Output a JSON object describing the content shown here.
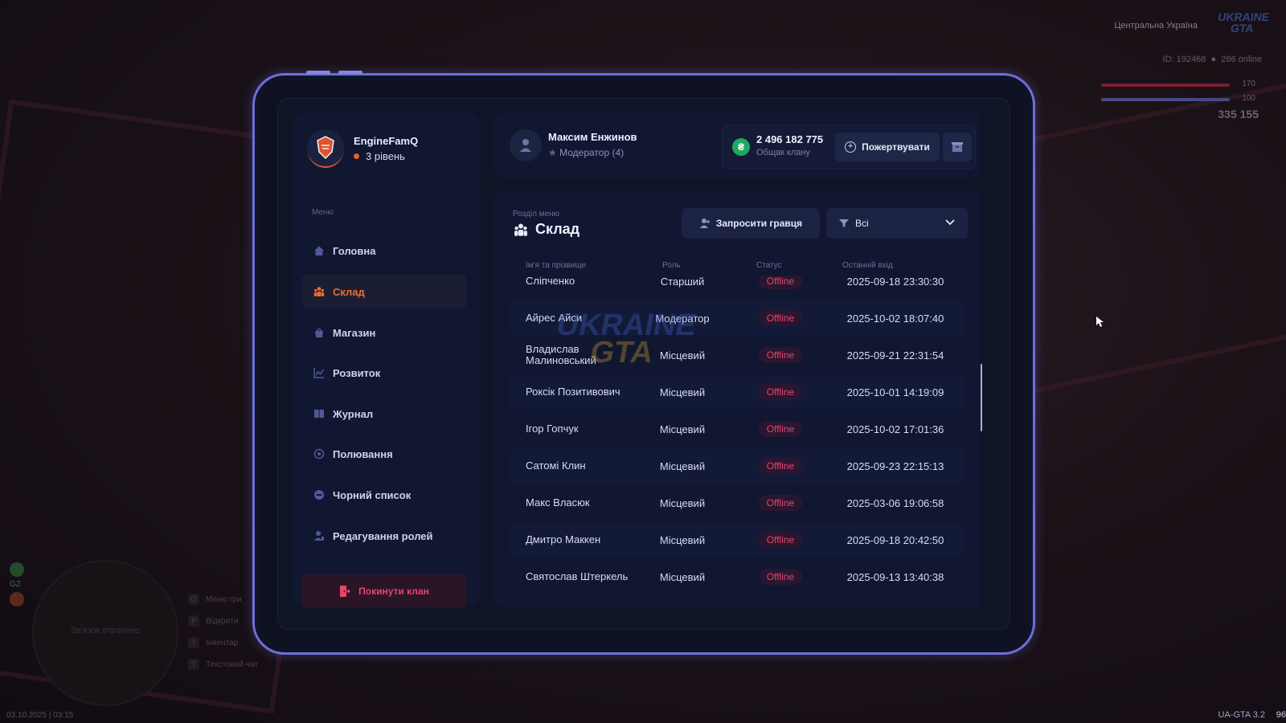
{
  "hud": {
    "region": "Центральна Україна",
    "id_text": "ID: 192468",
    "online_text": "286 online",
    "health": "170",
    "armor": "100",
    "money": "335 155",
    "logo_text": "UKRAINE GTA",
    "minimap_text": "Зв'язок втрачено",
    "gz": "GZ",
    "hints": [
      {
        "key": "O",
        "label": "Меню гри"
      },
      {
        "key": "P",
        "label": "Відкрити"
      },
      {
        "key": "I",
        "label": "Інвентар"
      },
      {
        "key": "T",
        "label": "Текстовий чат"
      }
    ],
    "date": "03.10.2025 | 03:15",
    "version": "UA-GTA 3.2",
    "fps": "96"
  },
  "clan": {
    "name": "EngineFamQ",
    "level": "3 рівень"
  },
  "menu": {
    "title": "Меню",
    "items": [
      {
        "label": "Головна",
        "icon": "home-icon"
      },
      {
        "label": "Склад",
        "icon": "people-icon",
        "active": true
      },
      {
        "label": "Магазин",
        "icon": "shop-icon"
      },
      {
        "label": "Розвиток",
        "icon": "chart-icon"
      },
      {
        "label": "Журнал",
        "icon": "book-icon"
      },
      {
        "label": "Полювання",
        "icon": "target-icon"
      },
      {
        "label": "Чорний список",
        "icon": "block-icon"
      },
      {
        "label": "Редагування ролей",
        "icon": "user-edit-icon"
      }
    ],
    "leave_label": "Покинути клан"
  },
  "user": {
    "name": "Максим Енжинов",
    "role": "Модератор (4)"
  },
  "bank": {
    "icon_symbol": "₴",
    "amount": "2 496 182 775",
    "label": "Общак клану",
    "donate_label": "Пожертвувати"
  },
  "section": {
    "subtitle": "Розділ меню",
    "title": "Склад",
    "invite_label": "Запросити гравця",
    "filter_value": "Всі"
  },
  "table": {
    "columns": [
      "Ім'я та прізвище",
      "Роль",
      "Статус",
      "Останній вхід"
    ],
    "rows": [
      {
        "name": "Сліпченко",
        "role": "Старший",
        "status": "Offline",
        "last": "2025-09-18 23:30:30"
      },
      {
        "name": "Айрес Айси",
        "role": "Модератор",
        "status": "Offline",
        "last": "2025-10-02 18:07:40"
      },
      {
        "name": "Владислав Малиновський",
        "role": "Місцевий",
        "status": "Offline",
        "last": "2025-09-21 22:31:54"
      },
      {
        "name": "Роксік Позитивович",
        "role": "Місцевий",
        "status": "Offline",
        "last": "2025-10-01 14:19:09"
      },
      {
        "name": "Ігор Гопчук",
        "role": "Місцевий",
        "status": "Offline",
        "last": "2025-10-02 17:01:36"
      },
      {
        "name": "Сатомі Клин",
        "role": "Місцевий",
        "status": "Offline",
        "last": "2025-09-23 22:15:13"
      },
      {
        "name": "Макс Власюк",
        "role": "Місцевий",
        "status": "Offline",
        "last": "2025-03-06 19:06:58"
      },
      {
        "name": "Дмитро Маккен",
        "role": "Місцевий",
        "status": "Offline",
        "last": "2025-09-18 20:42:50"
      },
      {
        "name": "Святослав Штеркель",
        "role": "Місцевий",
        "status": "Offline",
        "last": "2025-09-13 13:40:38"
      }
    ]
  },
  "colors": {
    "accent": "#f06a36",
    "danger": "#e8456a",
    "tablet_border": "#6f6fd6",
    "bank_green": "#1faa63"
  }
}
